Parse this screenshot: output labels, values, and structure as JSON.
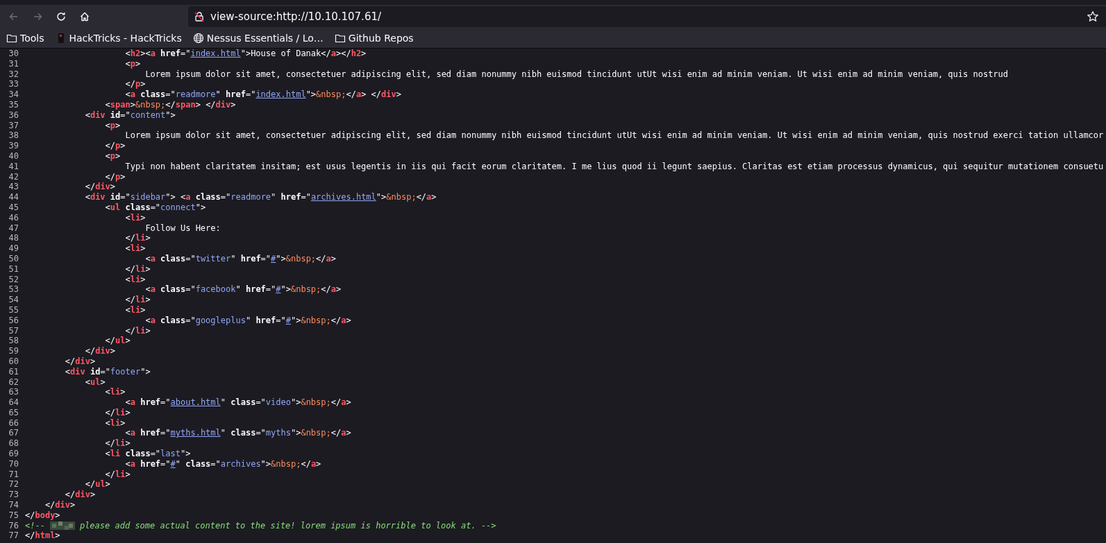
{
  "toolbar": {
    "buttons": [
      {
        "kind": "back",
        "disabled": true
      },
      {
        "kind": "forward",
        "disabled": true
      },
      {
        "kind": "reload",
        "disabled": false
      },
      {
        "kind": "home",
        "disabled": false
      }
    ],
    "url": "view-source:http://10.10.107.61/"
  },
  "bookmarks": [
    {
      "kind": "folder",
      "label": "Tools"
    },
    {
      "kind": "favicon",
      "label": "HackTricks - HackTricks"
    },
    {
      "kind": "globe",
      "label": "Nessus Essentials / Lo…"
    },
    {
      "kind": "folder",
      "label": "Github Repos"
    }
  ],
  "source_lines": [
    {
      "number": "30",
      "tokens": [
        {
          "kind": "punct",
          "text": "                    <"
        },
        {
          "kind": "tag",
          "text": "h2"
        },
        {
          "kind": "punct",
          "text": "><"
        },
        {
          "kind": "tag",
          "text": "a"
        },
        {
          "kind": "attr",
          "text": " href"
        },
        {
          "kind": "punct",
          "text": "=\""
        },
        {
          "kind": "link",
          "text": "index.html"
        },
        {
          "kind": "punct",
          "text": "\">House of Danak</"
        },
        {
          "kind": "tag",
          "text": "a"
        },
        {
          "kind": "punct",
          "text": "></"
        },
        {
          "kind": "tag",
          "text": "h2"
        },
        {
          "kind": "punct",
          "text": ">"
        }
      ]
    },
    {
      "number": "31",
      "tokens": [
        {
          "kind": "punct",
          "text": "                    <"
        },
        {
          "kind": "tag",
          "text": "p"
        },
        {
          "kind": "punct",
          "text": ">"
        }
      ]
    },
    {
      "number": "32",
      "tokens": [
        {
          "kind": "text",
          "text": "                        Lorem ipsum dolor sit amet, consectetuer adipiscing elit, sed diam nonummy nibh euismod tincidunt utUt wisi enim ad minim veniam. Ut wisi enim ad minim veniam, quis nostrud"
        }
      ]
    },
    {
      "number": "33",
      "tokens": [
        {
          "kind": "punct",
          "text": "                    </"
        },
        {
          "kind": "tag",
          "text": "p"
        },
        {
          "kind": "punct",
          "text": ">"
        }
      ]
    },
    {
      "number": "34",
      "tokens": [
        {
          "kind": "punct",
          "text": "                    <"
        },
        {
          "kind": "tag",
          "text": "a"
        },
        {
          "kind": "attr",
          "text": " class"
        },
        {
          "kind": "punct",
          "text": "=\""
        },
        {
          "kind": "value",
          "text": "readmore"
        },
        {
          "kind": "punct",
          "text": "\""
        },
        {
          "kind": "attr",
          "text": " href"
        },
        {
          "kind": "punct",
          "text": "=\""
        },
        {
          "kind": "link",
          "text": "index.html"
        },
        {
          "kind": "punct",
          "text": "\">"
        },
        {
          "kind": "entity",
          "text": "&nbsp;"
        },
        {
          "kind": "punct",
          "text": "</"
        },
        {
          "kind": "tag",
          "text": "a"
        },
        {
          "kind": "punct",
          "text": "> </"
        },
        {
          "kind": "tag",
          "text": "div"
        },
        {
          "kind": "punct",
          "text": ">"
        }
      ]
    },
    {
      "number": "35",
      "tokens": [
        {
          "kind": "punct",
          "text": "                <"
        },
        {
          "kind": "tag",
          "text": "span"
        },
        {
          "kind": "punct",
          "text": ">"
        },
        {
          "kind": "entity",
          "text": "&nbsp;"
        },
        {
          "kind": "punct",
          "text": "</"
        },
        {
          "kind": "tag",
          "text": "span"
        },
        {
          "kind": "punct",
          "text": "> </"
        },
        {
          "kind": "tag",
          "text": "div"
        },
        {
          "kind": "punct",
          "text": ">"
        }
      ]
    },
    {
      "number": "36",
      "tokens": [
        {
          "kind": "punct",
          "text": "            <"
        },
        {
          "kind": "tag",
          "text": "div"
        },
        {
          "kind": "attr",
          "text": " id"
        },
        {
          "kind": "punct",
          "text": "=\""
        },
        {
          "kind": "value",
          "text": "content"
        },
        {
          "kind": "punct",
          "text": "\">"
        }
      ]
    },
    {
      "number": "37",
      "tokens": [
        {
          "kind": "punct",
          "text": "                <"
        },
        {
          "kind": "tag",
          "text": "p"
        },
        {
          "kind": "punct",
          "text": ">"
        }
      ]
    },
    {
      "number": "38",
      "tokens": [
        {
          "kind": "text",
          "text": "                    Lorem ipsum dolor sit amet, consectetuer adipiscing elit, sed diam nonummy nibh euismod tincidunt utUt wisi enim ad minim veniam. Ut wisi enim ad minim veniam, quis nostrud exerci tation ullamcor"
        }
      ]
    },
    {
      "number": "39",
      "tokens": [
        {
          "kind": "punct",
          "text": "                </"
        },
        {
          "kind": "tag",
          "text": "p"
        },
        {
          "kind": "punct",
          "text": ">"
        }
      ]
    },
    {
      "number": "40",
      "tokens": [
        {
          "kind": "punct",
          "text": "                <"
        },
        {
          "kind": "tag",
          "text": "p"
        },
        {
          "kind": "punct",
          "text": ">"
        }
      ]
    },
    {
      "number": "41",
      "tokens": [
        {
          "kind": "text",
          "text": "                    Typi non habent claritatem insitam; est usus legentis in iis qui facit eorum claritatem. I me lius quod ii legunt saepius. Claritas est etiam processus dynamicus, qui sequitur mutationem consuetu"
        }
      ]
    },
    {
      "number": "42",
      "tokens": [
        {
          "kind": "punct",
          "text": "                </"
        },
        {
          "kind": "tag",
          "text": "p"
        },
        {
          "kind": "punct",
          "text": ">"
        }
      ]
    },
    {
      "number": "43",
      "tokens": [
        {
          "kind": "punct",
          "text": "            </"
        },
        {
          "kind": "tag",
          "text": "div"
        },
        {
          "kind": "punct",
          "text": ">"
        }
      ]
    },
    {
      "number": "44",
      "tokens": [
        {
          "kind": "punct",
          "text": "            <"
        },
        {
          "kind": "tag",
          "text": "div"
        },
        {
          "kind": "attr",
          "text": " id"
        },
        {
          "kind": "punct",
          "text": "=\""
        },
        {
          "kind": "value",
          "text": "sidebar"
        },
        {
          "kind": "punct",
          "text": "\"> <"
        },
        {
          "kind": "tag",
          "text": "a"
        },
        {
          "kind": "attr",
          "text": " class"
        },
        {
          "kind": "punct",
          "text": "=\""
        },
        {
          "kind": "value",
          "text": "readmore"
        },
        {
          "kind": "punct",
          "text": "\""
        },
        {
          "kind": "attr",
          "text": " href"
        },
        {
          "kind": "punct",
          "text": "=\""
        },
        {
          "kind": "link",
          "text": "archives.html"
        },
        {
          "kind": "punct",
          "text": "\">"
        },
        {
          "kind": "entity",
          "text": "&nbsp;"
        },
        {
          "kind": "punct",
          "text": "</"
        },
        {
          "kind": "tag",
          "text": "a"
        },
        {
          "kind": "punct",
          "text": ">"
        }
      ]
    },
    {
      "number": "45",
      "tokens": [
        {
          "kind": "punct",
          "text": "                <"
        },
        {
          "kind": "tag",
          "text": "ul"
        },
        {
          "kind": "attr",
          "text": " class"
        },
        {
          "kind": "punct",
          "text": "=\""
        },
        {
          "kind": "value",
          "text": "connect"
        },
        {
          "kind": "punct",
          "text": "\">"
        }
      ]
    },
    {
      "number": "46",
      "tokens": [
        {
          "kind": "punct",
          "text": "                    <"
        },
        {
          "kind": "tag",
          "text": "li"
        },
        {
          "kind": "punct",
          "text": ">"
        }
      ]
    },
    {
      "number": "47",
      "tokens": [
        {
          "kind": "text",
          "text": "                        Follow Us Here:"
        }
      ]
    },
    {
      "number": "48",
      "tokens": [
        {
          "kind": "punct",
          "text": "                    </"
        },
        {
          "kind": "tag",
          "text": "li"
        },
        {
          "kind": "punct",
          "text": ">"
        }
      ]
    },
    {
      "number": "49",
      "tokens": [
        {
          "kind": "punct",
          "text": "                    <"
        },
        {
          "kind": "tag",
          "text": "li"
        },
        {
          "kind": "punct",
          "text": ">"
        }
      ]
    },
    {
      "number": "50",
      "tokens": [
        {
          "kind": "punct",
          "text": "                        <"
        },
        {
          "kind": "tag",
          "text": "a"
        },
        {
          "kind": "attr",
          "text": " class"
        },
        {
          "kind": "punct",
          "text": "=\""
        },
        {
          "kind": "value",
          "text": "twitter"
        },
        {
          "kind": "punct",
          "text": "\""
        },
        {
          "kind": "attr",
          "text": " href"
        },
        {
          "kind": "punct",
          "text": "=\""
        },
        {
          "kind": "link",
          "text": "#"
        },
        {
          "kind": "punct",
          "text": "\">"
        },
        {
          "kind": "entity",
          "text": "&nbsp;"
        },
        {
          "kind": "punct",
          "text": "</"
        },
        {
          "kind": "tag",
          "text": "a"
        },
        {
          "kind": "punct",
          "text": ">"
        }
      ]
    },
    {
      "number": "51",
      "tokens": [
        {
          "kind": "punct",
          "text": "                    </"
        },
        {
          "kind": "tag",
          "text": "li"
        },
        {
          "kind": "punct",
          "text": ">"
        }
      ]
    },
    {
      "number": "52",
      "tokens": [
        {
          "kind": "punct",
          "text": "                    <"
        },
        {
          "kind": "tag",
          "text": "li"
        },
        {
          "kind": "punct",
          "text": ">"
        }
      ]
    },
    {
      "number": "53",
      "tokens": [
        {
          "kind": "punct",
          "text": "                        <"
        },
        {
          "kind": "tag",
          "text": "a"
        },
        {
          "kind": "attr",
          "text": " class"
        },
        {
          "kind": "punct",
          "text": "=\""
        },
        {
          "kind": "value",
          "text": "facebook"
        },
        {
          "kind": "punct",
          "text": "\""
        },
        {
          "kind": "attr",
          "text": " href"
        },
        {
          "kind": "punct",
          "text": "=\""
        },
        {
          "kind": "link",
          "text": "#"
        },
        {
          "kind": "punct",
          "text": "\">"
        },
        {
          "kind": "entity",
          "text": "&nbsp;"
        },
        {
          "kind": "punct",
          "text": "</"
        },
        {
          "kind": "tag",
          "text": "a"
        },
        {
          "kind": "punct",
          "text": ">"
        }
      ]
    },
    {
      "number": "54",
      "tokens": [
        {
          "kind": "punct",
          "text": "                    </"
        },
        {
          "kind": "tag",
          "text": "li"
        },
        {
          "kind": "punct",
          "text": ">"
        }
      ]
    },
    {
      "number": "55",
      "tokens": [
        {
          "kind": "punct",
          "text": "                    <"
        },
        {
          "kind": "tag",
          "text": "li"
        },
        {
          "kind": "punct",
          "text": ">"
        }
      ]
    },
    {
      "number": "56",
      "tokens": [
        {
          "kind": "punct",
          "text": "                        <"
        },
        {
          "kind": "tag",
          "text": "a"
        },
        {
          "kind": "attr",
          "text": " class"
        },
        {
          "kind": "punct",
          "text": "=\""
        },
        {
          "kind": "value",
          "text": "googleplus"
        },
        {
          "kind": "punct",
          "text": "\""
        },
        {
          "kind": "attr",
          "text": " href"
        },
        {
          "kind": "punct",
          "text": "=\""
        },
        {
          "kind": "link",
          "text": "#"
        },
        {
          "kind": "punct",
          "text": "\">"
        },
        {
          "kind": "entity",
          "text": "&nbsp;"
        },
        {
          "kind": "punct",
          "text": "</"
        },
        {
          "kind": "tag",
          "text": "a"
        },
        {
          "kind": "punct",
          "text": ">"
        }
      ]
    },
    {
      "number": "57",
      "tokens": [
        {
          "kind": "punct",
          "text": "                    </"
        },
        {
          "kind": "tag",
          "text": "li"
        },
        {
          "kind": "punct",
          "text": ">"
        }
      ]
    },
    {
      "number": "58",
      "tokens": [
        {
          "kind": "punct",
          "text": "                </"
        },
        {
          "kind": "tag",
          "text": "ul"
        },
        {
          "kind": "punct",
          "text": ">"
        }
      ]
    },
    {
      "number": "59",
      "tokens": [
        {
          "kind": "punct",
          "text": "            </"
        },
        {
          "kind": "tag",
          "text": "div"
        },
        {
          "kind": "punct",
          "text": ">"
        }
      ]
    },
    {
      "number": "60",
      "tokens": [
        {
          "kind": "punct",
          "text": "        </"
        },
        {
          "kind": "tag",
          "text": "div"
        },
        {
          "kind": "punct",
          "text": ">"
        }
      ]
    },
    {
      "number": "61",
      "tokens": [
        {
          "kind": "punct",
          "text": "        <"
        },
        {
          "kind": "tag",
          "text": "div"
        },
        {
          "kind": "attr",
          "text": " id"
        },
        {
          "kind": "punct",
          "text": "=\""
        },
        {
          "kind": "value",
          "text": "footer"
        },
        {
          "kind": "punct",
          "text": "\">"
        }
      ]
    },
    {
      "number": "62",
      "tokens": [
        {
          "kind": "punct",
          "text": "            <"
        },
        {
          "kind": "tag",
          "text": "ul"
        },
        {
          "kind": "punct",
          "text": ">"
        }
      ]
    },
    {
      "number": "63",
      "tokens": [
        {
          "kind": "punct",
          "text": "                <"
        },
        {
          "kind": "tag",
          "text": "li"
        },
        {
          "kind": "punct",
          "text": ">"
        }
      ]
    },
    {
      "number": "64",
      "tokens": [
        {
          "kind": "punct",
          "text": "                    <"
        },
        {
          "kind": "tag",
          "text": "a"
        },
        {
          "kind": "attr",
          "text": " href"
        },
        {
          "kind": "punct",
          "text": "=\""
        },
        {
          "kind": "link",
          "text": "about.html"
        },
        {
          "kind": "punct",
          "text": "\""
        },
        {
          "kind": "attr",
          "text": " class"
        },
        {
          "kind": "punct",
          "text": "=\""
        },
        {
          "kind": "value",
          "text": "video"
        },
        {
          "kind": "punct",
          "text": "\">"
        },
        {
          "kind": "entity",
          "text": "&nbsp;"
        },
        {
          "kind": "punct",
          "text": "</"
        },
        {
          "kind": "tag",
          "text": "a"
        },
        {
          "kind": "punct",
          "text": ">"
        }
      ]
    },
    {
      "number": "65",
      "tokens": [
        {
          "kind": "punct",
          "text": "                </"
        },
        {
          "kind": "tag",
          "text": "li"
        },
        {
          "kind": "punct",
          "text": ">"
        }
      ]
    },
    {
      "number": "66",
      "tokens": [
        {
          "kind": "punct",
          "text": "                <"
        },
        {
          "kind": "tag",
          "text": "li"
        },
        {
          "kind": "punct",
          "text": ">"
        }
      ]
    },
    {
      "number": "67",
      "tokens": [
        {
          "kind": "punct",
          "text": "                    <"
        },
        {
          "kind": "tag",
          "text": "a"
        },
        {
          "kind": "attr",
          "text": " href"
        },
        {
          "kind": "punct",
          "text": "=\""
        },
        {
          "kind": "link",
          "text": "myths.html"
        },
        {
          "kind": "punct",
          "text": "\""
        },
        {
          "kind": "attr",
          "text": " class"
        },
        {
          "kind": "punct",
          "text": "=\""
        },
        {
          "kind": "value",
          "text": "myths"
        },
        {
          "kind": "punct",
          "text": "\">"
        },
        {
          "kind": "entity",
          "text": "&nbsp;"
        },
        {
          "kind": "punct",
          "text": "</"
        },
        {
          "kind": "tag",
          "text": "a"
        },
        {
          "kind": "punct",
          "text": ">"
        }
      ]
    },
    {
      "number": "68",
      "tokens": [
        {
          "kind": "punct",
          "text": "                </"
        },
        {
          "kind": "tag",
          "text": "li"
        },
        {
          "kind": "punct",
          "text": ">"
        }
      ]
    },
    {
      "number": "69",
      "tokens": [
        {
          "kind": "punct",
          "text": "                <"
        },
        {
          "kind": "tag",
          "text": "li"
        },
        {
          "kind": "attr",
          "text": " class"
        },
        {
          "kind": "punct",
          "text": "=\""
        },
        {
          "kind": "value",
          "text": "last"
        },
        {
          "kind": "punct",
          "text": "\">"
        }
      ]
    },
    {
      "number": "70",
      "tokens": [
        {
          "kind": "punct",
          "text": "                    <"
        },
        {
          "kind": "tag",
          "text": "a"
        },
        {
          "kind": "attr",
          "text": " href"
        },
        {
          "kind": "punct",
          "text": "=\""
        },
        {
          "kind": "link",
          "text": "#"
        },
        {
          "kind": "punct",
          "text": "\""
        },
        {
          "kind": "attr",
          "text": " class"
        },
        {
          "kind": "punct",
          "text": "=\""
        },
        {
          "kind": "value",
          "text": "archives"
        },
        {
          "kind": "punct",
          "text": "\">"
        },
        {
          "kind": "entity",
          "text": "&nbsp;"
        },
        {
          "kind": "punct",
          "text": "</"
        },
        {
          "kind": "tag",
          "text": "a"
        },
        {
          "kind": "punct",
          "text": ">"
        }
      ]
    },
    {
      "number": "71",
      "tokens": [
        {
          "kind": "punct",
          "text": "                </"
        },
        {
          "kind": "tag",
          "text": "li"
        },
        {
          "kind": "punct",
          "text": ">"
        }
      ]
    },
    {
      "number": "72",
      "tokens": [
        {
          "kind": "punct",
          "text": "            </"
        },
        {
          "kind": "tag",
          "text": "ul"
        },
        {
          "kind": "punct",
          "text": ">"
        }
      ]
    },
    {
      "number": "73",
      "tokens": [
        {
          "kind": "punct",
          "text": "        </"
        },
        {
          "kind": "tag",
          "text": "div"
        },
        {
          "kind": "punct",
          "text": ">"
        }
      ]
    },
    {
      "number": "74",
      "tokens": [
        {
          "kind": "punct",
          "text": "    </"
        },
        {
          "kind": "tag",
          "text": "div"
        },
        {
          "kind": "punct",
          "text": ">"
        }
      ]
    },
    {
      "number": "75",
      "tokens": [
        {
          "kind": "punct",
          "text": "</"
        },
        {
          "kind": "tag",
          "text": "body"
        },
        {
          "kind": "punct",
          "text": ">"
        }
      ]
    },
    {
      "number": "76",
      "tokens": [
        {
          "kind": "comment",
          "text": "<!--"
        },
        {
          "kind": "redacted"
        },
        {
          "kind": "comment",
          "text": "please add some actual content to the site! lorem ipsum is horrible to look at. -->"
        }
      ]
    },
    {
      "number": "77",
      "tokens": [
        {
          "kind": "punct",
          "text": "</"
        },
        {
          "kind": "tag",
          "text": "html"
        },
        {
          "kind": "punct",
          "text": ">"
        }
      ]
    }
  ]
}
